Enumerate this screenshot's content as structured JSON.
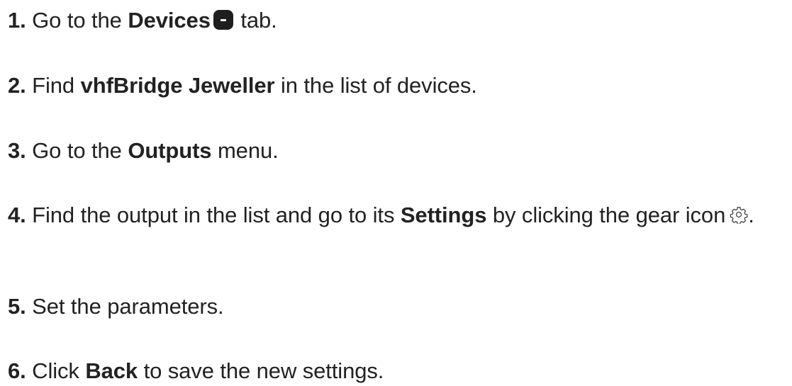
{
  "steps": [
    {
      "number": "1.",
      "pre": "Go to the",
      "bold": "Devices",
      "post": "tab.",
      "icon": "devices-tab-icon"
    },
    {
      "number": "2.",
      "pre": "Find",
      "bold": "vhfBridge Jeweller",
      "post": "in the list of devices."
    },
    {
      "number": "3.",
      "pre": "Go to the",
      "bold": "Outputs",
      "post": "menu."
    },
    {
      "number": "4.",
      "pre": "Find the output in the list and go to its",
      "bold": "Settings",
      "post": "by clicking the gear icon",
      "trail": ".",
      "icon": "gear-icon"
    },
    {
      "number": "5.",
      "pre": "Set the parameters."
    },
    {
      "number": "6.",
      "pre": "Click",
      "bold": "Back",
      "post": "to save the new settings."
    }
  ]
}
